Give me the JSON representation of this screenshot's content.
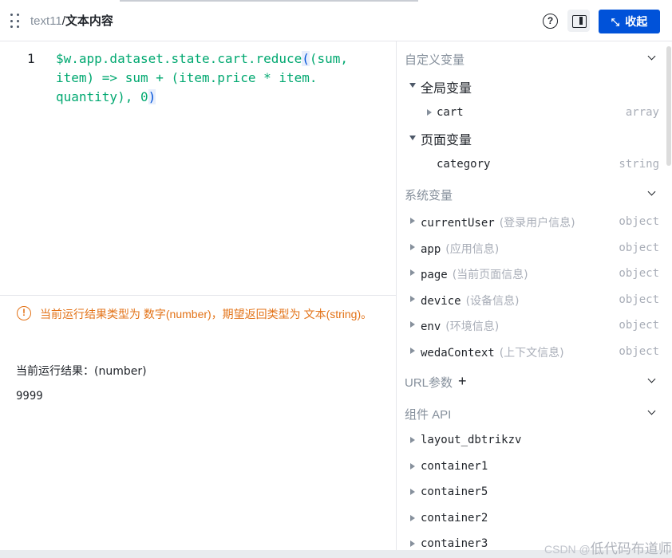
{
  "header": {
    "breadcrumb_component": "text11",
    "breadcrumb_separator": "/",
    "breadcrumb_property": "文本内容",
    "help_label": "?",
    "collapse_label": "收起"
  },
  "editor": {
    "line_number": "1",
    "code_part1": "$w.app.dataset.state.cart.reduce",
    "code_open_paren": "(",
    "code_part2": "(sum,\nitem) => sum + (item.price * item.\nquantity), 0",
    "code_close_paren": ")"
  },
  "result": {
    "warning_text": "当前运行结果类型为 数字(number)，期望返回类型为 文本(string)。",
    "result_label": "当前运行结果：(number)",
    "result_value": "9999"
  },
  "panel": {
    "custom_vars": {
      "title": "自定义变量",
      "global": {
        "label": "全局变量",
        "items": [
          {
            "name": "cart",
            "type": "array"
          }
        ]
      },
      "page": {
        "label": "页面变量",
        "items": [
          {
            "name": "category",
            "type": "string"
          }
        ]
      }
    },
    "system_vars": {
      "title": "系统变量",
      "items": [
        {
          "name": "currentUser",
          "desc": "(登录用户信息)",
          "type": "object"
        },
        {
          "name": "app",
          "desc": "(应用信息)",
          "type": "object"
        },
        {
          "name": "page",
          "desc": "(当前页面信息)",
          "type": "object"
        },
        {
          "name": "device",
          "desc": "(设备信息)",
          "type": "object"
        },
        {
          "name": "env",
          "desc": "(环境信息)",
          "type": "object"
        },
        {
          "name": "wedaContext",
          "desc": "(上下文信息)",
          "type": "object"
        }
      ]
    },
    "url_params": {
      "title": "URL参数",
      "add_label": "+"
    },
    "component_api": {
      "title": "组件 API",
      "items": [
        {
          "name": "layout_dbtrikzv"
        },
        {
          "name": "container1"
        },
        {
          "name": "container5"
        },
        {
          "name": "container2"
        },
        {
          "name": "container3"
        }
      ]
    }
  },
  "watermark": {
    "prefix": "CSDN @",
    "name": "低代码布道师"
  },
  "colors": {
    "primary": "#0052d9",
    "code_green": "#00a870",
    "warning_orange": "#e37318",
    "muted_gray": "#a9aeb8"
  }
}
